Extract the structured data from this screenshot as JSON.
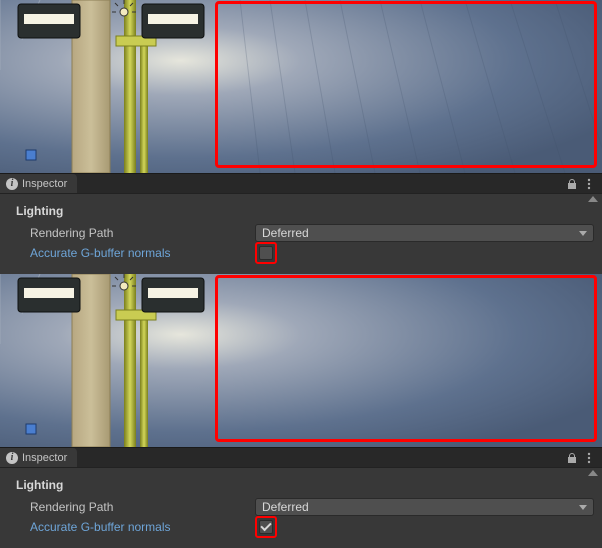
{
  "inspector": {
    "tab_label": "Inspector",
    "section": "Lighting",
    "rendering_path_label": "Rendering Path",
    "rendering_path_value": "Deferred",
    "accurate_gbuffer_label": "Accurate G-buffer normals"
  },
  "blocks": [
    {
      "accurate_gbuffer_checked": false,
      "banding": true
    },
    {
      "accurate_gbuffer_checked": true,
      "banding": false
    }
  ],
  "colors": {
    "highlight": "#ff0000",
    "link": "#6ea5d8"
  }
}
